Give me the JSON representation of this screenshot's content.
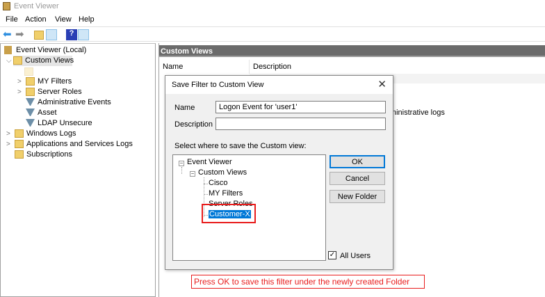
{
  "window": {
    "title": "Event Viewer"
  },
  "menu": [
    "File",
    "Action",
    "View",
    "Help"
  ],
  "tree": {
    "root": "Event Viewer (Local)",
    "custom_views": "Custom Views",
    "children": [
      "MY Filters",
      "Server Roles",
      "Administrative Events",
      "Asset",
      "LDAP Unsecure"
    ],
    "others": [
      "Windows Logs",
      "Applications and Services Logs",
      "Subscriptions"
    ]
  },
  "right": {
    "header": "Custom Views",
    "col_name": "Name",
    "col_desc": "Description",
    "partial_desc": "ninistrative logs"
  },
  "dialog": {
    "title": "Save Filter to Custom View",
    "name_label": "Name",
    "name_value": "Logon Event for 'user1'",
    "desc_label": "Description",
    "desc_value": "",
    "select_label": "Select where to save the Custom view:",
    "tree": {
      "root": "Event Viewer",
      "custom": "Custom Views",
      "items": [
        "Cisco",
        "MY Filters",
        "Server Roles"
      ],
      "selected": "Customer-X"
    },
    "ok": "OK",
    "cancel": "Cancel",
    "new_folder": "New Folder",
    "all_users": "All Users",
    "all_users_checked": true
  },
  "annotation": "Press OK to save this filter under the newly created Folder",
  "colors": {
    "accent": "#0078d7",
    "annotation": "#e81b1b",
    "header": "#6b6b6b"
  }
}
